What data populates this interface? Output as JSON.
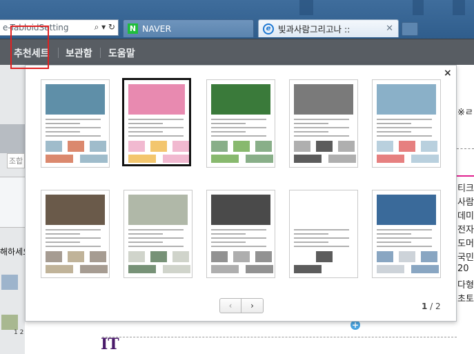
{
  "browser": {
    "address_text": "e-TabloidSetting",
    "address_controls": "⌕ ▾ ↻",
    "tabs": [
      {
        "label": "NAVER",
        "badge": "N"
      },
      {
        "label": "빛과사람그리고나 ::",
        "badge": "e"
      }
    ],
    "tab_close": "✕"
  },
  "toolbar": {
    "items": [
      {
        "label": "추천세트"
      },
      {
        "label": "보관함"
      },
      {
        "label": "도움말"
      }
    ]
  },
  "background_page": {
    "left_chip": "조합",
    "left_text": "해하세요",
    "left_pages": "1 2",
    "right_lines": [
      "※ㄹ",
      "티크",
      "사람",
      "데미",
      "전자",
      "도머",
      "국민",
      "20",
      "다형",
      "초토"
    ],
    "bottom_text": "IT",
    "plus": "+"
  },
  "modal": {
    "close": "×",
    "prev": "‹",
    "next": "›",
    "page_current": "1",
    "page_separator": " / ",
    "page_total": "2",
    "templates": [
      {
        "hero": "#5f8fa8",
        "accent": "#d26b4a",
        "selected": false
      },
      {
        "hero": "#e88ab0",
        "accent": "#f0b84a",
        "selected": true
      },
      {
        "hero": "#3a7a3a",
        "accent": "#6aa84a",
        "selected": false
      },
      {
        "hero": "#7a7a7a",
        "accent": "#333333",
        "selected": false
      },
      {
        "hero": "#8ab0c8",
        "accent": "#e06060",
        "selected": false
      },
      {
        "hero": "#6a5a4a",
        "accent": "#b0a080",
        "selected": false
      },
      {
        "hero": "#b0b8a8",
        "accent": "#557755",
        "selected": false
      },
      {
        "hero": "#4a4a4a",
        "accent": "#9a9a9a",
        "selected": false
      },
      {
        "hero": "#ffffff",
        "accent": "#333333",
        "selected": false
      },
      {
        "hero": "#3a6a9a",
        "accent": "#c0c8d0",
        "selected": false
      }
    ]
  }
}
